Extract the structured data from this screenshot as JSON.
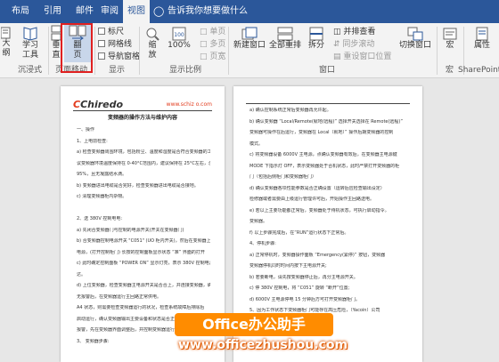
{
  "tabs": [
    {
      "label": "布局"
    },
    {
      "label": "引用"
    },
    {
      "label": "邮件"
    },
    {
      "label": "审阅"
    },
    {
      "label": "视图"
    }
  ],
  "tell_me": "告诉我你想要做什么",
  "ribbon": {
    "left_cut_btn": "大纲",
    "read_tools": "学习\n工具",
    "read_tools_l1": "学习",
    "read_tools_l2": "工具",
    "vertical_l1": "垂",
    "vertical_l2": "直",
    "page_flip_l1": "翻",
    "page_flip_l2": "页",
    "checkbox_ruler": "标尺",
    "checkbox_gridlines": "网格线",
    "checkbox_nav": "导航窗格",
    "zoom_l1": "缩",
    "zoom_l2": "放",
    "zoom_100": "100%",
    "single_page": "单页",
    "multi_page": "多页",
    "page_width": "页宽",
    "new_window": "新建窗口",
    "arrange_all": "全部重排",
    "split": "拆分",
    "side_by_side": "并排查看",
    "sync_scroll": "同步滚动",
    "reset_window": "重设窗口位置",
    "switch_window": "切换窗口",
    "macros": "宏",
    "properties": "属性",
    "group_immersive": "沉浸式",
    "group_page_move": "页面移动",
    "group_show": "显示",
    "group_zoom": "显示比例",
    "group_window": "窗口",
    "group_macros": "宏",
    "group_sharepoint": "SharePoint"
  },
  "page1": {
    "logo_main": "Chiredo",
    "site": "www.schiz o.com",
    "title": "变频器的操作方法与维护内容",
    "lines": [
      "一、操作",
      "1、上电前检查:",
      "a) 检查变频器周围环境，包括粉尘、温度和湿度是否符合变频器的工作。建",
      "议变频器环境温度保持在 0-40°C范围内，建议保持在 25°C左右，湿度不超过",
      "95%，且无凝露结水滴。",
      "b) 变频器进出电缆是否完好，检查变频器进出电缆是否接地。",
      "c) 清理变频器柜内杂物。",
      "",
      "2、送 380V 控制电电:",
      "a) 先闭合变频器门与控制的电源开关(开关在变频器门)",
      "b) 合变频器控制电源开关 \"C051\" (UO 柜内开关)，然后在变频器上面控制",
      "电源，(打开控制柜门) 长按的控制面板显示状态 “准” 界面的打开",
      "c) 此时确定控制面板 “POWER ON” 显示灯亮，表示 380V 控制电源已送",
      "达。",
      "d) 上位变频器，检查变频器主电源开关是否合上，并连接变频器，确认",
      "无报警后，在变频器运行主回路正常供电。",
      "A4 状态，则需要检查变频器运行的状况，检查系统故障后排除后",
      "启动运行，确认变频器输出主要设备和状态是否正常运行，确认无",
      "报警，先在变频器界面调整后，并控制变频器运行，再按变频器启动。",
      "3、 变频器步骤:"
    ]
  },
  "page2": {
    "lines": [
      "a) 确认控制系统正常后变频器再允许起。",
      "b) 确认变频器 “Local/Remote(就地/远程)” 选择开关选择在 Remote(远程)”",
      "变频器可操作在后运行，变频器在 Local（就地）” 操作后期变频器的控制",
      "模式。",
      "c) 将变频器设备 6000V 主电源，点确认变频器有效后，在变频器主电源键",
      "MODE 下指示灯 OFF，表示变频器处于合机状态，此时严禁打开变频器的柜",
      "门（包括后侧柜门和变频器柜门）",
      "d) 确认变频器各项性能参数是否正确设置（运转后应检查输出设定）",
      "检修器或者需要由上级运行管理许可后，开始操作主回路送电。",
      "e) 若以上主要功能都正常后，变频器处于待机状态，可执行启动指令。",
      "变频器。",
      "f) 以上步骤完成后，在“RUN”运行状态下正常后。",
      "4、停机步骤:",
      "a) 正常停机时，变频器操作面板 “Emergency(紧停)” 按钮，变频器",
      "变频器停机同时时间内按下主电源开关;",
      "b) 若要断电，请先按变频器停止后，再分主电源开关。",
      "c) 停 380V 控制电，将 “C051” 旋转 “断开”位置;",
      "d) 6000V 主电源停电 15 分钟后方可打开变频器柜门。",
      "5、因为工作状态下变频器柜门可能存在高压危险，（Yacoin）公司",
      "机。"
    ]
  },
  "watermark": {
    "label": "Office办公助手",
    "url": "www.officezhushou.com"
  }
}
